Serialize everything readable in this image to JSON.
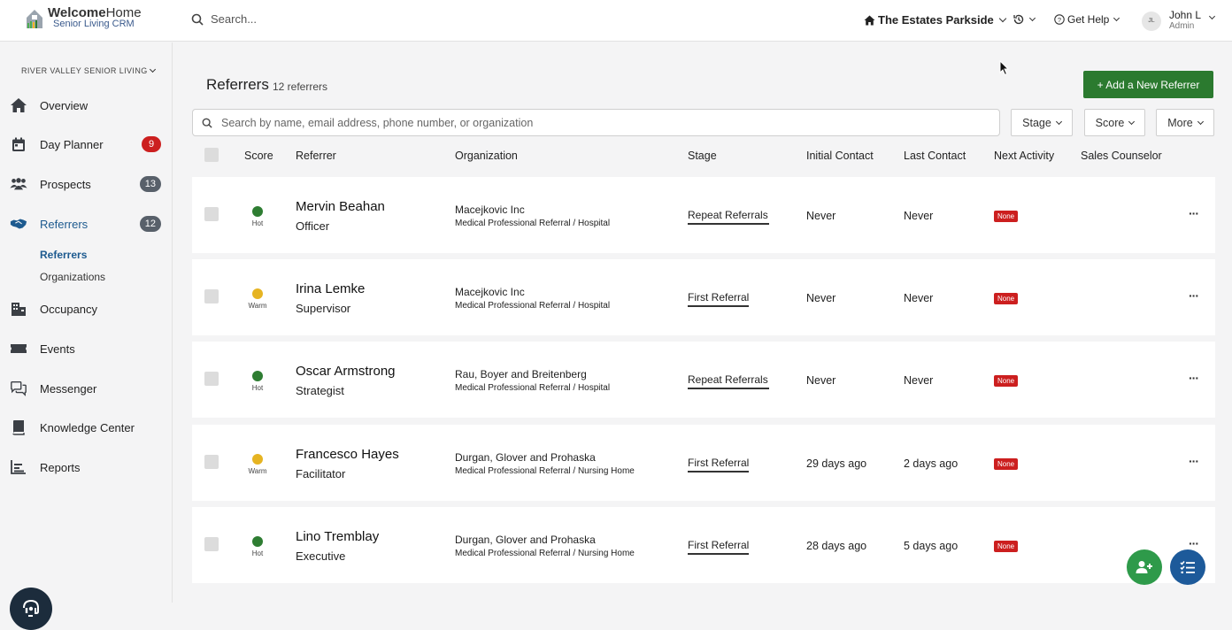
{
  "header": {
    "brand_bold": "Welcome",
    "brand_light": "Home",
    "brand_sub": "Senior Living CRM",
    "search_placeholder": "Search...",
    "community": "The Estates Parkside",
    "help": "Get Help",
    "user_initials": "JL",
    "user_name": "John L",
    "user_role": "Admin"
  },
  "sidebar": {
    "org": "RIVER VALLEY SENIOR LIVING",
    "items": [
      {
        "label": "Overview",
        "icon": "home-icon"
      },
      {
        "label": "Day Planner",
        "icon": "calendar-icon",
        "badge": "9"
      },
      {
        "label": "Prospects",
        "icon": "people-icon",
        "badge": "13"
      },
      {
        "label": "Referrers",
        "icon": "handshake-icon",
        "badge": "12"
      },
      {
        "label": "Occupancy",
        "icon": "building-icon"
      },
      {
        "label": "Events",
        "icon": "ticket-icon"
      },
      {
        "label": "Messenger",
        "icon": "chat-icon"
      },
      {
        "label": "Knowledge Center",
        "icon": "book-icon"
      },
      {
        "label": "Reports",
        "icon": "chart-icon"
      }
    ],
    "sub_items": [
      "Referrers",
      "Organizations"
    ]
  },
  "main": {
    "title": "Referrers",
    "count": "12 referrers",
    "add_button": "+ Add a New Referrer",
    "search_placeholder": "Search by name, email address, phone number, or organization",
    "filters": [
      "Stage",
      "Score",
      "More"
    ],
    "columns": [
      "Score",
      "Referrer",
      "Organization",
      "Stage",
      "Initial Contact",
      "Last Contact",
      "Next Activity",
      "Sales Counselor"
    ],
    "rows": [
      {
        "score": "Hot",
        "score_color": "#2e7d32",
        "name": "Mervin Beahan",
        "title": "Officer",
        "org": "Macejkovic Inc",
        "org_type": "Medical Professional Referral / Hospital",
        "stage": "Repeat Referrals",
        "stage_progress": 1.0,
        "initial": "Never",
        "last": "Never",
        "next": "None",
        "more": "···"
      },
      {
        "score": "Warm",
        "score_color": "#e6b422",
        "name": "Irina Lemke",
        "title": "Supervisor",
        "org": "Macejkovic Inc",
        "org_type": "Medical Professional Referral / Hospital",
        "stage": "First Referral",
        "stage_progress": 0.8,
        "initial": "Never",
        "last": "Never",
        "next": "None",
        "more": "···"
      },
      {
        "score": "Hot",
        "score_color": "#2e7d32",
        "name": "Oscar Armstrong",
        "title": "Strategist",
        "org": "Rau, Boyer and Breitenberg",
        "org_type": "Medical Professional Referral / Hospital",
        "stage": "Repeat Referrals",
        "stage_progress": 1.0,
        "initial": "Never",
        "last": "Never",
        "next": "None",
        "more": "···"
      },
      {
        "score": "Warm",
        "score_color": "#e6b422",
        "name": "Francesco Hayes",
        "title": "Facilitator",
        "org": "Durgan, Glover and Prohaska",
        "org_type": "Medical Professional Referral / Nursing Home",
        "stage": "First Referral",
        "stage_progress": 0.8,
        "initial": "29 days ago",
        "last": "2 days ago",
        "next": "None",
        "more": "···"
      },
      {
        "score": "Hot",
        "score_color": "#2e7d32",
        "name": "Lino Tremblay",
        "title": "Executive",
        "org": "Durgan, Glover and Prohaska",
        "org_type": "Medical Professional Referral / Nursing Home",
        "stage": "First Referral",
        "stage_progress": 0.8,
        "initial": "28 days ago",
        "last": "5 days ago",
        "next": "None",
        "more": "···"
      }
    ]
  }
}
